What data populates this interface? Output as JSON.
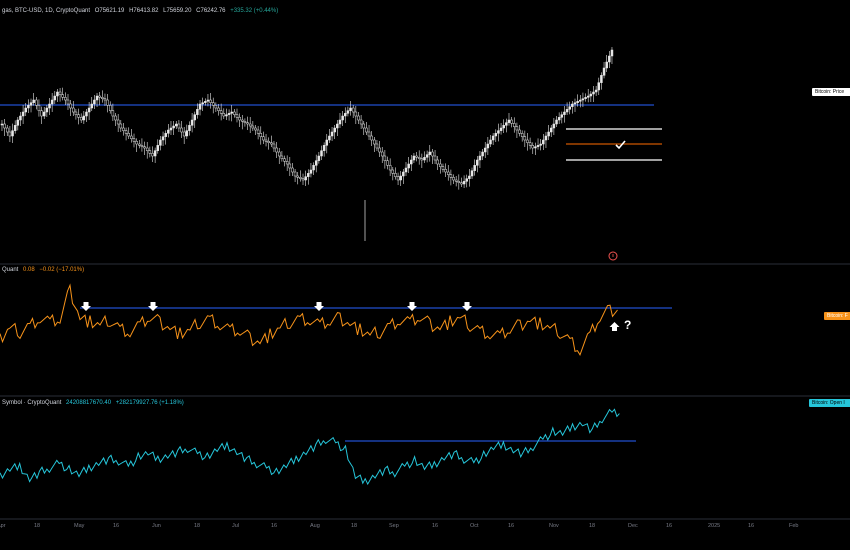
{
  "panes": [
    {
      "id": "price",
      "legend": {
        "name": "gas, BTC-USD, 1D, CryptoQuant",
        "open": "O75621.19",
        "high": "H76413.82",
        "low": "L75659.20",
        "close": "C76242.76",
        "change": "+335.32 (+0.44%)"
      },
      "tag": "Bitcoin: Price"
    },
    {
      "id": "oscillator",
      "legend": {
        "name": "Quant",
        "value": "0.08",
        "change": "−0.02 (−17.01%)"
      },
      "tag": "Bitcoin: F"
    },
    {
      "id": "open-interest",
      "legend": {
        "name": "Symbol · CryptoQuant",
        "value": "24208817670.40",
        "change": "+282179927.76 (+1.18%)"
      },
      "tag": "Bitcoin: Open I"
    }
  ],
  "annotations": {
    "question_mark": "?"
  },
  "colors": {
    "price": "#e8e8e8",
    "oscillator": "#f7931a",
    "open_interest": "#26c6da",
    "levels": "#2962ff",
    "support": "#ff6d00",
    "marker": "#ef5350"
  },
  "x_axis": {
    "ticks": [
      "Apr",
      "18",
      "May",
      "16",
      "Jun",
      "18",
      "Jul",
      "16",
      "Aug",
      "18",
      "Sep",
      "16",
      "Oct",
      "16",
      "Nov",
      "18",
      "Dec",
      "16",
      "2025",
      "16",
      "Feb"
    ]
  },
  "chart_data": [
    {
      "type": "candlestick",
      "title": "BTC-USD",
      "y_relative": [
        0.58,
        0.52,
        0.6,
        0.66,
        0.7,
        0.62,
        0.68,
        0.74,
        0.7,
        0.64,
        0.6,
        0.66,
        0.72,
        0.7,
        0.62,
        0.56,
        0.52,
        0.48,
        0.46,
        0.42,
        0.5,
        0.55,
        0.58,
        0.52,
        0.6,
        0.68,
        0.7,
        0.66,
        0.62,
        0.64,
        0.6,
        0.58,
        0.55,
        0.5,
        0.48,
        0.42,
        0.38,
        0.32,
        0.3,
        0.35,
        0.42,
        0.5,
        0.56,
        0.62,
        0.66,
        0.6,
        0.54,
        0.48,
        0.42,
        0.35,
        0.3,
        0.36,
        0.42,
        0.4,
        0.44,
        0.38,
        0.34,
        0.3,
        0.28,
        0.32,
        0.4,
        0.46,
        0.52,
        0.56,
        0.6,
        0.55,
        0.5,
        0.46,
        0.48,
        0.54,
        0.6,
        0.64,
        0.68,
        0.7,
        0.72,
        0.75,
        0.86,
        0.95
      ],
      "levels": [
        "resistance-high",
        "range-top",
        "range-bottom"
      ]
    },
    {
      "type": "line",
      "series": [
        {
          "name": "Bitcoin: F",
          "values": [
            0.4,
            0.52,
            0.48,
            0.55,
            0.62,
            0.58,
            0.6,
            0.9,
            0.62,
            0.58,
            0.55,
            0.6,
            0.52,
            0.48,
            0.55,
            0.62,
            0.58,
            0.52,
            0.46,
            0.5,
            0.58,
            0.62,
            0.55,
            0.5,
            0.48,
            0.42,
            0.38,
            0.45,
            0.52,
            0.58,
            0.62,
            0.6,
            0.55,
            0.58,
            0.62,
            0.56,
            0.5,
            0.45,
            0.48,
            0.55,
            0.6,
            0.58,
            0.62,
            0.56,
            0.52,
            0.58,
            0.62,
            0.55,
            0.5,
            0.46,
            0.44,
            0.5,
            0.55,
            0.6,
            0.56,
            0.52,
            0.48,
            0.4,
            0.3,
            0.45,
            0.62,
            0.7
          ]
        }
      ],
      "reference_level": 0.72
    },
    {
      "type": "line",
      "series": [
        {
          "name": "Bitcoin: Open I",
          "values": [
            0.2,
            0.28,
            0.32,
            0.18,
            0.25,
            0.3,
            0.35,
            0.28,
            0.22,
            0.3,
            0.36,
            0.4,
            0.38,
            0.32,
            0.42,
            0.46,
            0.4,
            0.44,
            0.48,
            0.52,
            0.46,
            0.42,
            0.5,
            0.55,
            0.48,
            0.4,
            0.35,
            0.3,
            0.25,
            0.32,
            0.4,
            0.48,
            0.55,
            0.62,
            0.58,
            0.5,
            0.2,
            0.15,
            0.22,
            0.28,
            0.25,
            0.32,
            0.38,
            0.3,
            0.34,
            0.42,
            0.46,
            0.4,
            0.36,
            0.44,
            0.52,
            0.56,
            0.5,
            0.46,
            0.54,
            0.62,
            0.7,
            0.68,
            0.76,
            0.8,
            0.72,
            0.85,
            0.92
          ]
        }
      ],
      "reference_level": 0.62
    }
  ]
}
